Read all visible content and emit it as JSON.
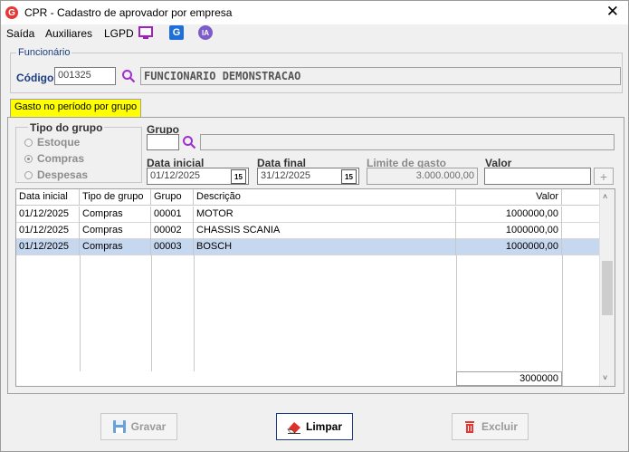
{
  "window": {
    "title": "CPR - Cadastro de aprovador por empresa",
    "close": "✕"
  },
  "menu": {
    "saida": "Saída",
    "auxiliares": "Auxiliares",
    "lgpd": "LGPD",
    "ia": "IA",
    "g": "G"
  },
  "funcionario": {
    "legend": "Funcionário",
    "codigo_label": "Código",
    "codigo_value": "001325",
    "nome": "FUNCIONARIO DEMONSTRACAO"
  },
  "tab": {
    "label": "Gasto no período por grupo"
  },
  "tipo_grupo": {
    "legend": "Tipo do grupo",
    "options": [
      "Estoque",
      "Compras",
      "Despesas"
    ],
    "selected": "Compras"
  },
  "form": {
    "grupo_label": "Grupo",
    "grupo_value": "",
    "grupo_desc": "",
    "data_inicial_label": "Data inicial",
    "data_inicial_value": "01/12/2025",
    "data_final_label": "Data final",
    "data_final_value": "31/12/2025",
    "limite_label": "Limite de gasto",
    "limite_value": "3.000.000,00",
    "valor_label": "Valor",
    "valor_value": "",
    "cal_icon": "15",
    "plus": "+"
  },
  "grid": {
    "headers": [
      "Data inicial",
      "Tipo de grupo",
      "Grupo",
      "Descrição",
      "Valor"
    ],
    "rows": [
      [
        "01/12/2025",
        "Compras",
        "00001",
        "MOTOR",
        "1000000,00"
      ],
      [
        "01/12/2025",
        "Compras",
        "00002",
        "CHASSIS SCANIA",
        "1000000,00"
      ],
      [
        "01/12/2025",
        "Compras",
        "00003",
        "BOSCH",
        "1000000,00"
      ]
    ],
    "selected_row": 2,
    "total": "3000000"
  },
  "buttons": {
    "gravar": "Gravar",
    "limpar": "Limpar",
    "excluir": "Excluir"
  },
  "colors": {
    "accent": "#1b3c82",
    "tab_bg": "#ffff00",
    "selected_row": "#c6d7f0",
    "excluir_red": "#e53935"
  }
}
